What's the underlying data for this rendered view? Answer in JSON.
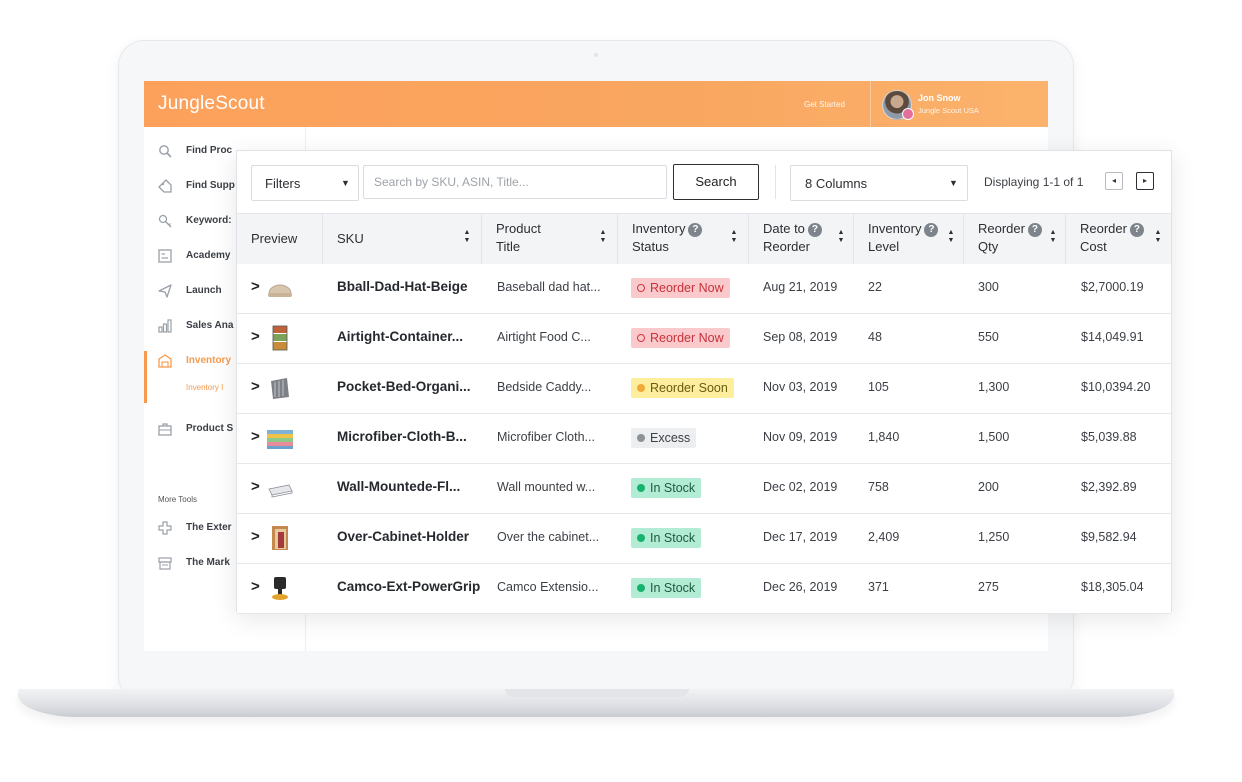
{
  "app": {
    "brand": "JungleScout",
    "get_started": "Get Started",
    "user_name": "Jon Snow",
    "user_account": "Jungle Scout USA"
  },
  "sidebar": {
    "items": [
      {
        "label": "Find Proc",
        "icon": "magnifier-icon"
      },
      {
        "label": "Find Supp",
        "icon": "tag-icon"
      },
      {
        "label": "Keyword:",
        "icon": "key-icon"
      },
      {
        "label": "Academy",
        "icon": "board-icon"
      },
      {
        "label": "Launch",
        "icon": "paper-plane-icon"
      },
      {
        "label": "Sales Ana",
        "icon": "bar-chart-icon"
      },
      {
        "label": "Inventory",
        "icon": "warehouse-icon"
      },
      {
        "label": "Product S",
        "icon": "briefcase-icon"
      }
    ],
    "active_sub": "Inventory I",
    "more_tools_label": "More Tools",
    "tools": [
      {
        "label": "The Exter",
        "icon": "puzzle-icon"
      },
      {
        "label": "The Mark",
        "icon": "store-icon"
      }
    ]
  },
  "toolbar": {
    "filters_label": "Filters",
    "search_placeholder": "Search by SKU, ASIN, Title...",
    "search_button": "Search",
    "columns_label": "8 Columns",
    "displaying": "Displaying 1-1 of 1",
    "prev_icon": "◂",
    "next_icon": "▸"
  },
  "table": {
    "headers": [
      {
        "line1": "Preview",
        "line2": ""
      },
      {
        "line1": "SKU",
        "line2": ""
      },
      {
        "line1": "Product",
        "line2": "Title"
      },
      {
        "line1": "Inventory",
        "line2": "Status"
      },
      {
        "line1": "Date to",
        "line2": "Reorder"
      },
      {
        "line1": "Inventory",
        "line2": "Level"
      },
      {
        "line1": "Reorder",
        "line2": "Qty"
      },
      {
        "line1": "Reorder",
        "line2": "Cost"
      }
    ],
    "rows": [
      {
        "sku": "Bball-Dad-Hat-Beige",
        "title": "Baseball dad hat...",
        "status": "Reorder Now",
        "status_key": "reorder-now",
        "date": "Aug 21, 2019",
        "level": "22",
        "qty": "300",
        "cost": "$2,7000.19",
        "thumb": "hat"
      },
      {
        "sku": "Airtight-Container...",
        "title": "Airtight Food C...",
        "status": "Reorder Now",
        "status_key": "reorder-now",
        "date": "Sep 08, 2019",
        "level": "48",
        "qty": "550",
        "cost": "$14,049.91",
        "thumb": "containers"
      },
      {
        "sku": "Pocket-Bed-Organi...",
        "title": "Bedside Caddy...",
        "status": "Reorder Soon",
        "status_key": "reorder-soon",
        "date": "Nov 03, 2019",
        "level": "105",
        "qty": "1,300",
        "cost": "$10,0394.20",
        "thumb": "caddy"
      },
      {
        "sku": "Microfiber-Cloth-B...",
        "title": "Microfiber Cloth...",
        "status": "Excess",
        "status_key": "excess",
        "date": "Nov 09, 2019",
        "level": "1,840",
        "qty": "1,500",
        "cost": "$5,039.88",
        "thumb": "cloths"
      },
      {
        "sku": "Wall-Mountede-Fl...",
        "title": "Wall mounted w...",
        "status": "In Stock",
        "status_key": "in-stock",
        "date": "Dec 02, 2019",
        "level": "758",
        "qty": "200",
        "cost": "$2,392.89",
        "thumb": "shelf"
      },
      {
        "sku": "Over-Cabinet-Holder",
        "title": "Over the cabinet...",
        "status": "In Stock",
        "status_key": "in-stock",
        "date": "Dec 17, 2019",
        "level": "2,409",
        "qty": "1,250",
        "cost": "$9,582.94",
        "thumb": "holder"
      },
      {
        "sku": "Camco-Ext-PowerGrip",
        "title": "Camco Extensio...",
        "status": "In Stock",
        "status_key": "in-stock",
        "date": "Dec 26, 2019",
        "level": "371",
        "qty": "275",
        "cost": "$18,305.04",
        "thumb": "cord"
      }
    ]
  }
}
